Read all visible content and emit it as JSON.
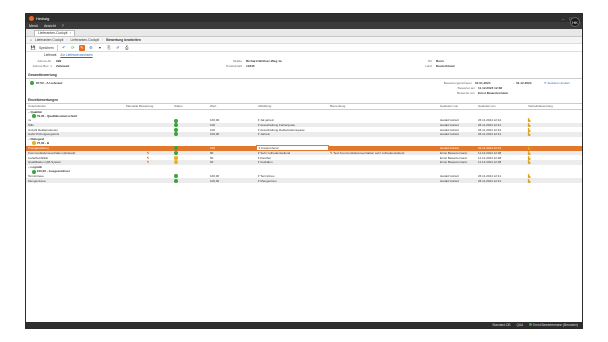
{
  "app": {
    "title": "Hedwig",
    "window_controls": [
      "–",
      "□",
      "×"
    ]
  },
  "menu": {
    "items": [
      "Menü",
      "Ansicht",
      "?"
    ],
    "avatar": "HK"
  },
  "tab": {
    "label": "Lieferanten-Cockpit",
    "close": "×"
  },
  "breadcrumb": [
    "Lieferanten Cockpit",
    "Lieferanten-Cockpit",
    "Bewertung bearbeiten"
  ],
  "toolbar": {
    "save_label": "Speichern"
  },
  "supplier_link": {
    "prefix": "Lieferant",
    "link": "Zur Lieferant wechseln"
  },
  "info": {
    "nr_label": "Adress-Nr.",
    "nr_value": "999",
    "name_label": "Adress-Bez. 1",
    "name_value": "Zahnwelt",
    "street_label": "Straße",
    "street_value": "Richard-Wollner-Weg 1a",
    "zip_label": "Postleitzahl",
    "zip_value": "12345",
    "city_label": "Ort",
    "city_value": "Bonn",
    "country_label": "Land",
    "country_value": "Deutschland"
  },
  "overall": {
    "section": "Gesamtbewertung",
    "value": "87,50 - A Lieferant",
    "period_label": "Bewertungszeitraum",
    "period_from": "01.01.2024",
    "period_to": "31.12.2024",
    "period_link": "Zeitraum ändern",
    "created_label": "Bewertet am",
    "created_value": "11.12.2024 12:38",
    "by_label": "Bewertet von",
    "by_value": "Ernst Bewertermann"
  },
  "items": {
    "section": "Einzelbewertungen",
    "columns": [
      "Unterkriterien",
      "Manuelle Bewertung",
      "Status",
      "Wert",
      "Abbildung",
      "Bemerkung",
      "Geändert von",
      "Geändert am",
      "Verlaufsbewertung"
    ],
    "rows": [
      {
        "kind": "group",
        "name": "Qualität"
      },
      {
        "kind": "sub",
        "name": "79,00 - Qualitätsunterschnitt",
        "dot": "green"
      },
      {
        "kind": "row",
        "name": "nv",
        "status": "green",
        "value": "100,00",
        "mapping": "Jat ja/nein",
        "note": "",
        "by": "Harald Gürtelt",
        "at": "26.11.2024 12:44",
        "trend": true,
        "alt": false
      },
      {
        "kind": "row",
        "name": "Stils",
        "status": "green",
        "value": "100",
        "mapping": "Ausschaltung Fehlerquote",
        "note": "",
        "by": "Harald Gürtelt",
        "at": "26.11.2024 12:41",
        "trend": true,
        "alt": true
      },
      {
        "kind": "row",
        "name": "Anzahl Reklamationen",
        "status": "green",
        "value": "100",
        "mapping": "Ausschaltung Reklamationsquote",
        "note": "",
        "by": "Harald Gürtelt",
        "at": "26.11.2024 12:44",
        "trend": true,
        "alt": false
      },
      {
        "kind": "row",
        "name": "Audit Prüfungsergebnis",
        "status": "green",
        "value": "100,00",
        "mapping": "Ja/nein",
        "note": "",
        "by": "Harald Gürtelt",
        "at": "26.11.2024 12:41",
        "trend": true,
        "alt": true
      },
      {
        "kind": "group",
        "name": "Dialogsaf"
      },
      {
        "kind": "sub",
        "name": "75,00 - B",
        "dot": "yellow"
      },
      {
        "kind": "row",
        "name": "Preisgestaltung",
        "manual": true,
        "status": "green",
        "value": "100",
        "mapping": "Ansprechend",
        "note": "",
        "by": "Harald Gürtelt",
        "at": "26.11.2024 12:41",
        "trend": true,
        "sel": true
      },
      {
        "kind": "row",
        "name": "Kommunikationsverhalten (Einkauf)",
        "manual": true,
        "status": "green",
        "value": "80",
        "mapping": "Sehr zufriedenstellend",
        "note": "Test Kommunikationsverhalten sehr zufriedenstellend",
        "by": "Ernst Bewertermann",
        "at": "11.12.2024 12:38",
        "trend": true,
        "alt": true
      },
      {
        "kind": "row",
        "name": "Lieferflexibilität",
        "manual": true,
        "status": "yellow",
        "value": "60",
        "mapping": "Flexibel",
        "note": "",
        "by": "Ernst Bewertermann",
        "at": "11.12.2024 12:38",
        "trend": true,
        "alt": false
      },
      {
        "kind": "row",
        "name": "Qualifikation QM-System",
        "manual": true,
        "status": "yellow",
        "value": "60",
        "mapping": "Ausfallen",
        "note": "",
        "by": "Ernst Bewertermann",
        "at": "11.12.2024 12:38",
        "trend": true,
        "alt": true
      },
      {
        "kind": "group",
        "name": "Logistik"
      },
      {
        "kind": "sub",
        "name": "100,00 - Ausgezeichnet",
        "dot": "green"
      },
      {
        "kind": "row",
        "name": "Termintreue",
        "status": "green",
        "value": "100,00",
        "mapping": "Termintreu",
        "note": "",
        "by": "Harald Gürtelt",
        "at": "26.11.2024 12:41",
        "trend": true,
        "alt": false
      },
      {
        "kind": "row",
        "name": "Mengentreue",
        "status": "green",
        "value": "100,00",
        "mapping": "Mengentreu",
        "note": "",
        "by": "Harald Gürtelt",
        "at": "26.11.2024 12:41",
        "trend": true,
        "alt": true
      }
    ]
  },
  "status": {
    "db": "Standard DB",
    "mode": "Q&A",
    "user": "Ernst Bewertermann (Benutzer)"
  }
}
